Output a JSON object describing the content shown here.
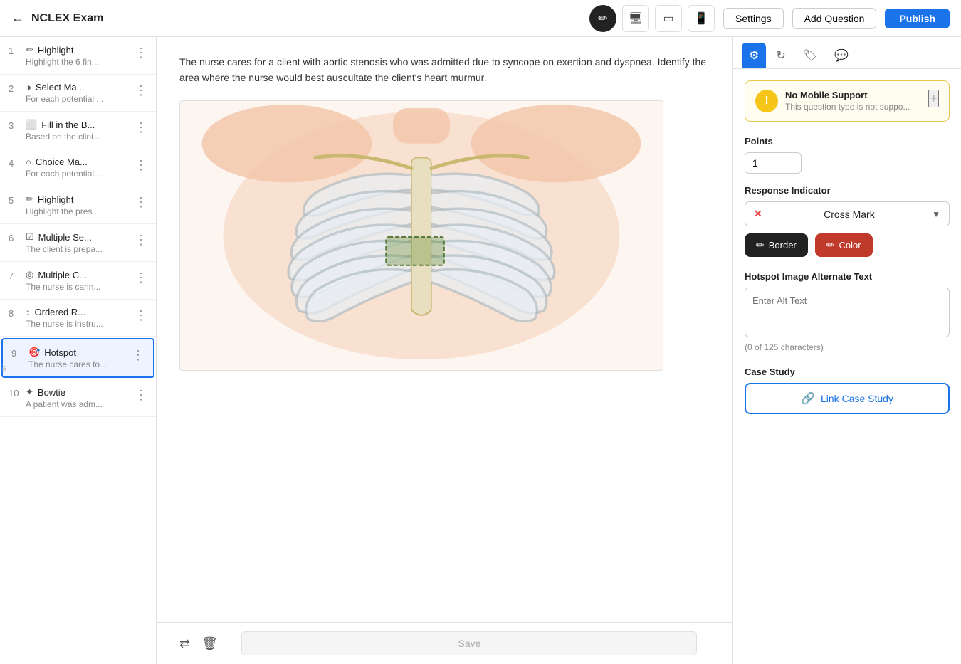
{
  "navbar": {
    "back_icon": "←",
    "title": "NCLEX Exam",
    "pencil_icon": "✏",
    "monitor_icon": "🖥",
    "tablet_icon": "⬜",
    "phone_icon": "📱",
    "settings_label": "Settings",
    "add_question_label": "Add Question",
    "publish_label": "Publish"
  },
  "sidebar": {
    "items": [
      {
        "num": "1",
        "icon": "✏",
        "label": "Highlight",
        "sub": "Highlight the 6 fin..."
      },
      {
        "num": "2",
        "icon": "◑",
        "label": "Select Ma...",
        "sub": "For each potential ..."
      },
      {
        "num": "3",
        "icon": "⬜",
        "label": "Fill in the B...",
        "sub": "Based on the clini..."
      },
      {
        "num": "4",
        "icon": "○",
        "label": "Choice Ma...",
        "sub": "For each potential ..."
      },
      {
        "num": "5",
        "icon": "✏",
        "label": "Highlight",
        "sub": "Highlight the pres..."
      },
      {
        "num": "6",
        "icon": "☑",
        "label": "Multiple Se...",
        "sub": "The client is prepa..."
      },
      {
        "num": "7",
        "icon": "◎",
        "label": "Multiple C...",
        "sub": "The nurse is carin..."
      },
      {
        "num": "8",
        "icon": "↕",
        "label": "Ordered R...",
        "sub": "The nurse is instru..."
      },
      {
        "num": "9",
        "icon": "🎯",
        "label": "Hotspot",
        "sub": "The nurse cares fo...",
        "active": true
      },
      {
        "num": "10",
        "icon": "✦",
        "label": "Bowtie",
        "sub": "A patient was adm..."
      }
    ]
  },
  "question": {
    "text": "The nurse cares for a client with aortic stenosis who was admitted due to syncope on exertion and dyspnea. Identify the area where the nurse would best auscultate the client's heart murmur."
  },
  "panel_tabs": [
    {
      "icon": "⚙",
      "active": true
    },
    {
      "icon": "🔁",
      "active": false
    },
    {
      "icon": "🏷",
      "active": false
    },
    {
      "icon": "💬",
      "active": false
    }
  ],
  "notice": {
    "icon": "!",
    "title": "No Mobile Support",
    "sub": "This question type is not suppo...",
    "close": "+"
  },
  "points": {
    "label": "Points",
    "value": "1"
  },
  "response_indicator": {
    "label": "Response Indicator",
    "selected": "Cross Mark",
    "x_symbol": "✕"
  },
  "style_buttons": {
    "border_label": "Border",
    "color_label": "Color"
  },
  "alt_text": {
    "label": "Hotspot Image Alternate Text",
    "placeholder": "Enter Alt Text",
    "count": "(0 of 125 characters)"
  },
  "case_study": {
    "label": "Case Study",
    "link_label": "Link Case Study"
  },
  "footer": {
    "swap_icon": "⇄",
    "trash_icon": "🗑",
    "save_label": "Save"
  }
}
